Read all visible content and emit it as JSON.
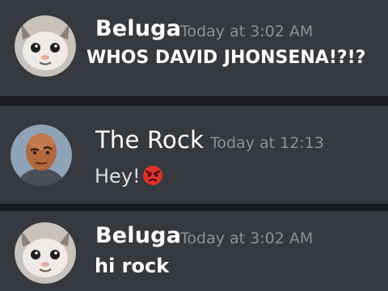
{
  "messages": [
    {
      "author": "Beluga",
      "timestamp": "Today at 3:02 AM",
      "text": "WHOS DAVID JHONSENA!?!?",
      "avatar_icon": "beluga-cat-avatar"
    },
    {
      "author": "The Rock",
      "timestamp": "Today at 12:13",
      "text": "Hey!",
      "reaction_emoji": "angry-face-emoji",
      "avatar_icon": "the-rock-avatar"
    },
    {
      "author": "Beluga",
      "timestamp": "Today at 3:02 AM",
      "text": "hi rock",
      "avatar_icon": "beluga-cat-avatar"
    }
  ],
  "colors": {
    "background": "#1a1b1e",
    "panel": "#36393f",
    "username": "#ffffff",
    "timestamp": "#8e9297",
    "message_text": "#dcddde",
    "emoji_red": "#e0312b"
  }
}
